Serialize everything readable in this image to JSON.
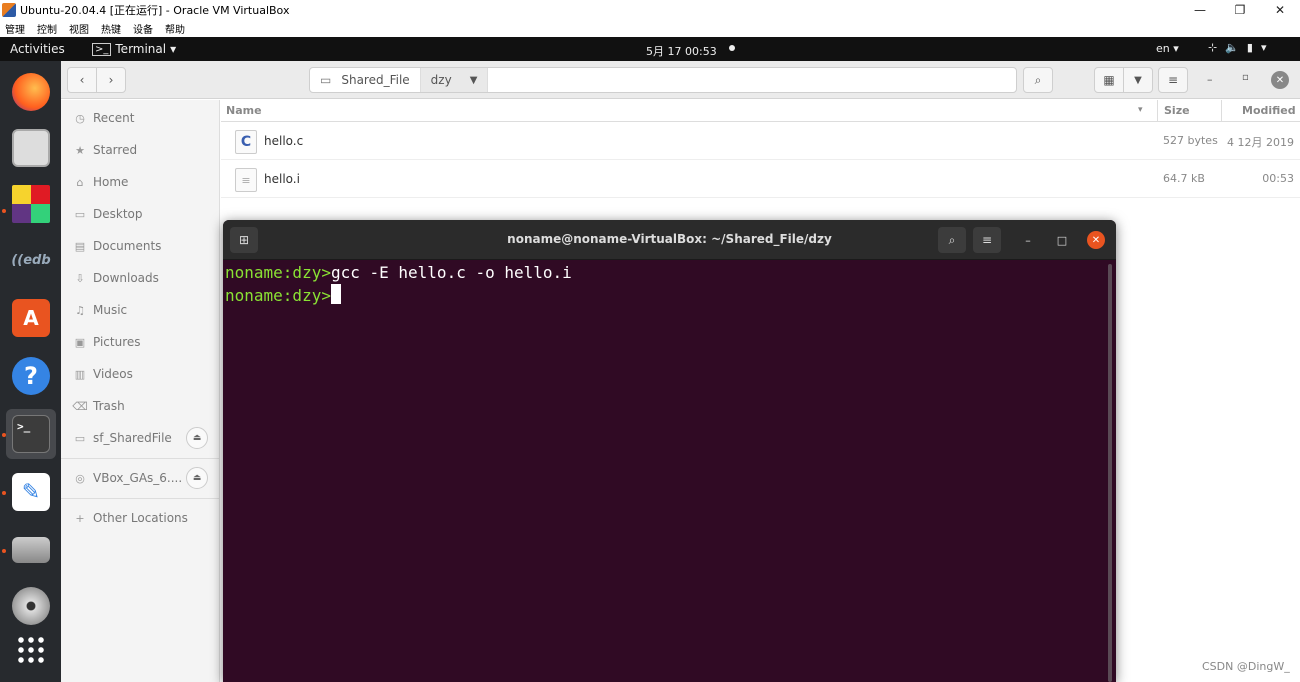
{
  "vbox": {
    "title": "Ubuntu-20.04.4 [正在运行] - Oracle VM VirtualBox",
    "menu": [
      "管理",
      "控制",
      "视图",
      "热键",
      "设备",
      "帮助"
    ]
  },
  "topbar": {
    "activities": "Activities",
    "app_menu": "Terminal",
    "clock": "5月 17  00:53",
    "lang": "en"
  },
  "files": {
    "path": {
      "root": "Shared_File",
      "current": "dzy"
    },
    "sidebar": {
      "items": [
        {
          "label": "Recent",
          "icon": "clock-icon"
        },
        {
          "label": "Starred",
          "icon": "star-icon"
        },
        {
          "label": "Home",
          "icon": "home-icon"
        },
        {
          "label": "Desktop",
          "icon": "desktop-icon"
        },
        {
          "label": "Documents",
          "icon": "document-icon"
        },
        {
          "label": "Downloads",
          "icon": "download-icon"
        },
        {
          "label": "Music",
          "icon": "music-icon"
        },
        {
          "label": "Pictures",
          "icon": "picture-icon"
        },
        {
          "label": "Videos",
          "icon": "video-icon"
        },
        {
          "label": "Trash",
          "icon": "trash-icon"
        },
        {
          "label": "sf_SharedFile",
          "icon": "drive-icon"
        },
        {
          "label": "VBox_GAs_6....",
          "icon": "disc-icon"
        },
        {
          "label": "Other Locations",
          "icon": "plus-icon"
        }
      ]
    },
    "columns": {
      "name": "Name",
      "size": "Size",
      "modified": "Modified"
    },
    "rows": [
      {
        "name": "hello.c",
        "size": "527 bytes",
        "modified": "4 12月 2019",
        "icon": "c-source-icon"
      },
      {
        "name": "hello.i",
        "size": "64.7 kB",
        "modified": "00:53",
        "icon": "text-file-icon"
      }
    ]
  },
  "terminal": {
    "title": "noname@noname-VirtualBox: ~/Shared_File/dzy",
    "lines": [
      {
        "prompt": "noname:dzy>",
        "command": "gcc -E hello.c -o hello.i"
      },
      {
        "prompt": "noname:dzy>",
        "command": ""
      }
    ]
  },
  "watermark": "CSDN @DingW_",
  "colors": {
    "terminal_bg": "#300a24",
    "prompt": "#8ae234",
    "accent": "#e95420"
  }
}
